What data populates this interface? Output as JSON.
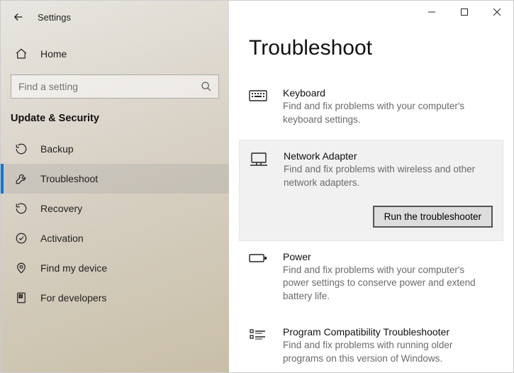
{
  "app": {
    "title": "Settings"
  },
  "home": {
    "label": "Home"
  },
  "search": {
    "placeholder": "Find a setting"
  },
  "section": {
    "title": "Update & Security"
  },
  "nav": {
    "items": [
      {
        "id": "backup",
        "label": "Backup"
      },
      {
        "id": "troubleshoot",
        "label": "Troubleshoot"
      },
      {
        "id": "recovery",
        "label": "Recovery"
      },
      {
        "id": "activation",
        "label": "Activation"
      },
      {
        "id": "find-my-device",
        "label": "Find my device"
      },
      {
        "id": "for-developers",
        "label": "For developers"
      }
    ]
  },
  "page": {
    "title": "Troubleshoot"
  },
  "troubleshooters": {
    "keyboard": {
      "title": "Keyboard",
      "desc": "Find and fix problems with your computer's keyboard settings."
    },
    "network": {
      "title": "Network Adapter",
      "desc": "Find and fix problems with wireless and other network adapters.",
      "button": "Run the troubleshooter"
    },
    "power": {
      "title": "Power",
      "desc": "Find and fix problems with your computer's power settings to conserve power and extend battery life."
    },
    "compat": {
      "title": "Program Compatibility Troubleshooter",
      "desc": "Find and fix problems with running older programs on this version of Windows."
    }
  }
}
